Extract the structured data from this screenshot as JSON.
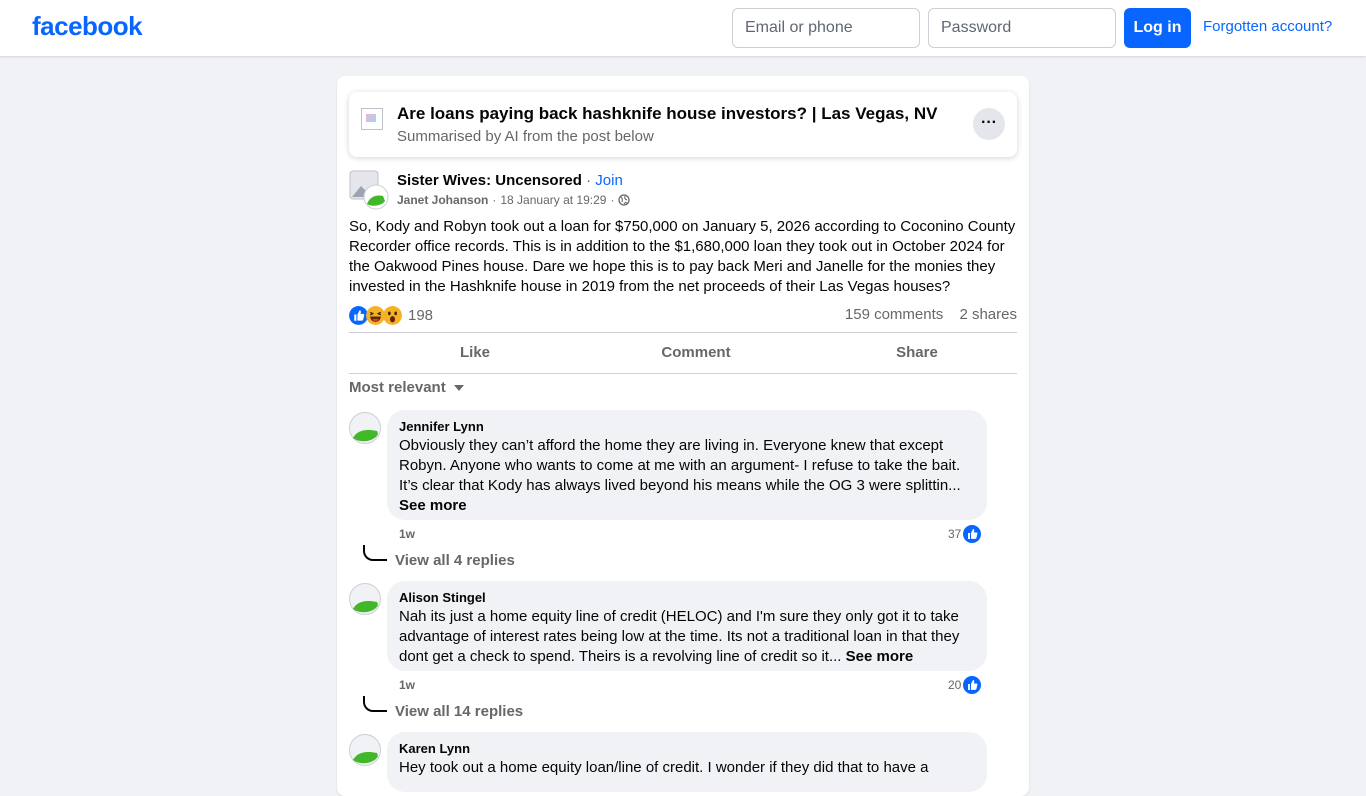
{
  "header": {
    "logo": "facebook",
    "email_placeholder": "Email or phone",
    "password_placeholder": "Password",
    "login_label": "Log in",
    "forgot_label": "Forgotten account?"
  },
  "ai_summary": {
    "title": "Are loans paying back hashknife house investors? | Las Vegas, NV",
    "subtitle": "Summarised by AI from the post below",
    "more_label": "···"
  },
  "post": {
    "group_name": "Sister Wives: Uncensored",
    "separator": "·",
    "join_label": "Join",
    "author": "Janet Johanson",
    "timestamp": "18 January at 19:29",
    "text": "So, Kody and Robyn took out a loan for $750,000 on January 5, 2026 according to Coconino County Recorder office records.  This is in addition to the $1,680,000 loan they took out in October 2024 for the Oakwood Pines house.  Dare we hope this is to pay back Meri and Janelle for the monies they invested in the Hashknife house in 2019 from the net proceeds of their Las Vegas houses?",
    "reaction_count": "198",
    "comments_count": "159 comments",
    "shares_count": "2 shares"
  },
  "actions": {
    "like": "Like",
    "comment": "Comment",
    "share": "Share"
  },
  "sort_label": "Most relevant",
  "comments": [
    {
      "name": "Jennifer Lynn",
      "text": "Obviously they can’t afford the home they are living in. Everyone knew that except Robyn. Anyone who wants to come at me with an argument- I refuse to take the bait. It’s clear that Kody has always lived beyond his means while the OG 3 were splittin...",
      "see_more": "See more",
      "time": "1w",
      "likes": "37",
      "replies": "View all 4 replies"
    },
    {
      "name": "Alison Stingel",
      "text": "Nah its just a home equity line of credit (HELOC) and I'm sure they only got it to take advantage of interest rates being low at the time. Its not a traditional loan in that they dont get a check to spend. Theirs is a revolving line of credit so it...",
      "see_more": "See more",
      "time": "1w",
      "likes": "20",
      "replies": "View all 14 replies"
    },
    {
      "name": "Karen Lynn",
      "text": "Hey took out a home equity loan/line of credit. I wonder if they did that to have a"
    }
  ],
  "colors": {
    "brand": "#0866ff",
    "page_bg": "#f0f2f5",
    "secondary_text": "#65676b"
  },
  "icons": [
    "globe-icon",
    "like-reaction-icon",
    "haha-reaction-icon",
    "wow-reaction-icon",
    "caret-down-icon"
  ]
}
